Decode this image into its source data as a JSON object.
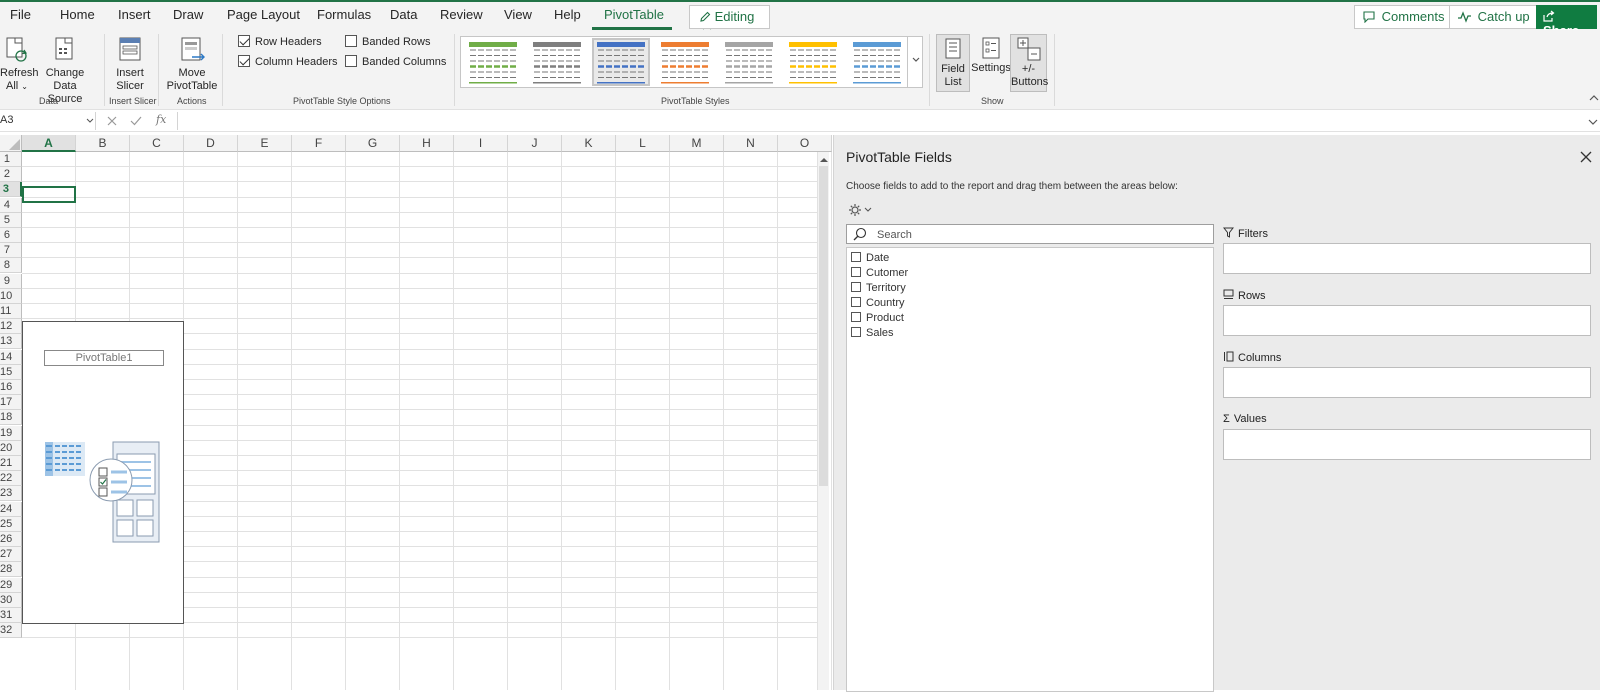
{
  "menu": {
    "tabs": [
      "File",
      "Home",
      "Insert",
      "Draw",
      "Page Layout",
      "Formulas",
      "Data",
      "Review",
      "View",
      "Help",
      "PivotTable"
    ],
    "active_tab": "PivotTable",
    "editing_label": "Editing",
    "comments_label": "Comments",
    "catchup_label": "Catch up",
    "share_label": "Share"
  },
  "ribbon": {
    "refresh_label_1": "Refresh",
    "refresh_label_2": "All",
    "change_source_1": "Change Data",
    "change_source_2": "Source",
    "group_data": "Data",
    "insert_slicer_1": "Insert",
    "insert_slicer_2": "Slicer",
    "group_insert_slicer": "Insert Slicer",
    "move_pivot_1": "Move",
    "move_pivot_2": "PivotTable",
    "group_actions": "Actions",
    "row_headers": "Row Headers",
    "column_headers": "Column Headers",
    "banded_rows": "Banded Rows",
    "banded_columns": "Banded Columns",
    "row_headers_checked": true,
    "column_headers_checked": true,
    "banded_rows_checked": false,
    "banded_columns_checked": false,
    "group_style_options": "PivotTable Style Options",
    "group_styles": "PivotTable Styles",
    "style_colors": [
      "#70ad47",
      "#7f7f7f",
      "#4472c4",
      "#ed7d31",
      "#a5a5a5",
      "#ffc000",
      "#5b9bd5"
    ],
    "selected_style_index": 2,
    "field_list_1": "Field",
    "field_list_2": "List",
    "settings_label": "Settings",
    "buttons_1": "+/-",
    "buttons_2": "Buttons",
    "group_show": "Show"
  },
  "formula_bar": {
    "name_box": "A3",
    "fx": "fx",
    "value": ""
  },
  "grid": {
    "columns": [
      "A",
      "B",
      "C",
      "D",
      "E",
      "F",
      "G",
      "H",
      "I",
      "J",
      "K",
      "L",
      "M",
      "N",
      "O"
    ],
    "rows": [
      "1",
      "2",
      "3",
      "4",
      "5",
      "6",
      "7",
      "8",
      "9",
      "10",
      "11",
      "12",
      "13",
      "14",
      "15",
      "16",
      "17",
      "18",
      "19",
      "20",
      "21",
      "22",
      "23",
      "24",
      "25",
      "26",
      "27",
      "28",
      "29",
      "30",
      "31",
      "32"
    ],
    "active_column": "A",
    "active_row": "3",
    "pivot_name": "PivotTable1"
  },
  "pane": {
    "title": "PivotTable Fields",
    "description": "Choose fields to add to the report and drag them between the areas below:",
    "search_placeholder": "Search",
    "fields": [
      "Date",
      "Cutomer",
      "Territory",
      "Country",
      "Product",
      "Sales"
    ],
    "areas": {
      "filters": "Filters",
      "rows": "Rows",
      "columns": "Columns",
      "values": "Values"
    }
  },
  "colors": {
    "accent": "#217346",
    "share_bg": "#107c41"
  }
}
